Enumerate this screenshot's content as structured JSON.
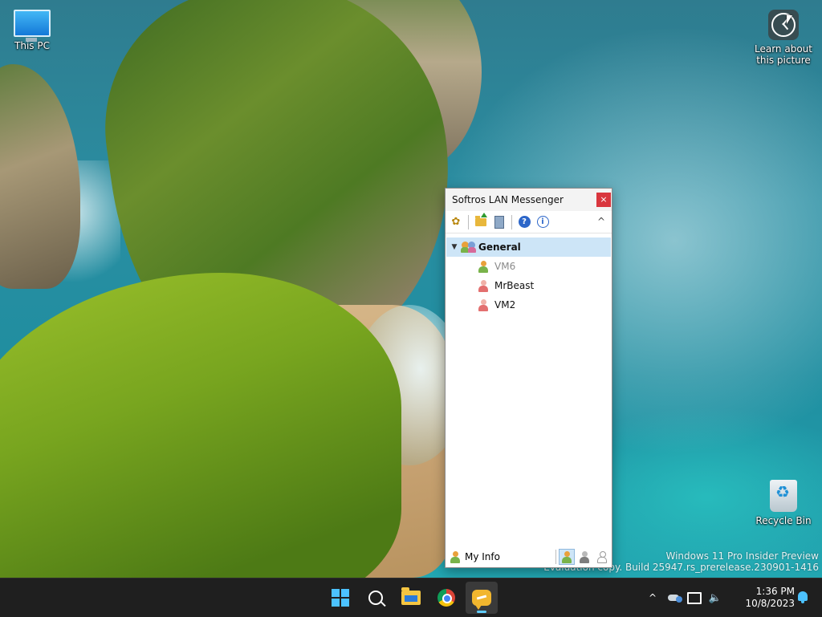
{
  "desktop": {
    "icons": [
      {
        "label": "This PC",
        "icon": "monitor-icon"
      },
      {
        "label": "Learn about\nthis picture",
        "icon": "spotlight-icon"
      },
      {
        "label": "Recycle Bin",
        "icon": "recycle-bin-icon"
      }
    ],
    "watermark": {
      "line1": "Windows 11 Pro Insider Preview",
      "line2": "Evaluation copy. Build 25947.rs_prerelease.230901-1416"
    }
  },
  "messenger": {
    "title": "Softros LAN Messenger",
    "close_label": "×",
    "toolbar": {
      "buttons": [
        "options-icon",
        "send-file-icon",
        "message-history-icon",
        "help-icon",
        "about-icon"
      ],
      "collapse_glyph": "^"
    },
    "group": {
      "name": "General",
      "expanded": true
    },
    "users": [
      {
        "name": "VM6",
        "status": "offline"
      },
      {
        "name": "MrBeast",
        "status": "online"
      },
      {
        "name": "VM2",
        "status": "online"
      }
    ],
    "statusbar": {
      "my_info_label": "My Info",
      "status_buttons": [
        "available",
        "away",
        "offline"
      ]
    }
  },
  "taskbar": {
    "apps": [
      "Start",
      "Search",
      "File Explorer",
      "Google Chrome",
      "Softros LAN Messenger"
    ],
    "active_app": "Softros LAN Messenger",
    "tray": {
      "chevron": "^",
      "time": "1:36 PM",
      "date": "10/8/2023"
    }
  },
  "colors": {
    "accent": "#4cc2ff",
    "selection": "#cde5f7",
    "close_red": "#d9363e",
    "taskbar": "#1f1f1f"
  }
}
